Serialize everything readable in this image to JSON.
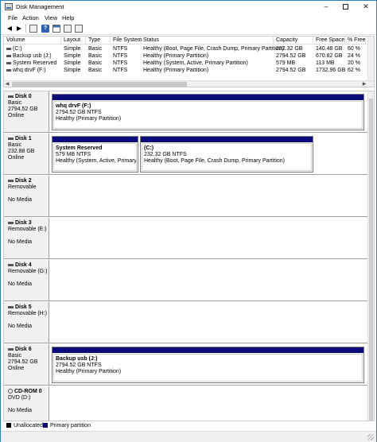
{
  "window": {
    "title": "Disk Management"
  },
  "menu": [
    "File",
    "Action",
    "View",
    "Help"
  ],
  "toolbar": {
    "icons": [
      "back-icon",
      "forward-icon",
      "properties-icon",
      "help-icon",
      "console-icon",
      "help-topics-icon",
      "settings-icon"
    ],
    "help_glyph": "?"
  },
  "volume_list": {
    "columns": [
      "Volume",
      "Layout",
      "Type",
      "File System",
      "Status",
      "Capacity",
      "Free Space",
      "% Free"
    ],
    "rows": [
      [
        "(C:)",
        "Simple",
        "Basic",
        "NTFS",
        "Healthy (Boot, Page File, Crash Dump, Primary Partition)",
        "232.32 GB",
        "140.48 GB",
        "60 %"
      ],
      [
        "Backup usb (J:)",
        "Simple",
        "Basic",
        "NTFS",
        "Healthy (Primary Partition)",
        "2794.52 GB",
        "670.82 GB",
        "24 %"
      ],
      [
        "System Reserved",
        "Simple",
        "Basic",
        "NTFS",
        "Healthy (System, Active, Primary Partition)",
        "579 MB",
        "113 MB",
        "20 %"
      ],
      [
        "whq drvF (F:)",
        "Simple",
        "Basic",
        "NTFS",
        "Healthy (Primary Partition)",
        "2794.52 GB",
        "1732.96 GB",
        "62 %"
      ]
    ]
  },
  "disks": [
    {
      "name": "Disk 0",
      "type": "Basic",
      "size": "2794.52 GB",
      "state": "Online",
      "partitions": [
        {
          "name": "whq drvF  (F:)",
          "size": "2794.52 GB NTFS",
          "status": "Healthy (Primary Partition)"
        }
      ]
    },
    {
      "name": "Disk 1",
      "type": "Basic",
      "size": "232.88 GB",
      "state": "Online",
      "partitions": [
        {
          "name": "System Reserved",
          "size": "579 MB NTFS",
          "status": "Healthy (System, Active, Primary Par"
        },
        {
          "name": "(C:)",
          "size": "232.32 GB NTFS",
          "status": "Healthy (Boot, Page File, Crash Dump, Primary Partition)"
        }
      ]
    },
    {
      "name": "Disk 2",
      "type": "Removable",
      "state": "No Media"
    },
    {
      "name": "Disk 3",
      "type": "Removable (E:)",
      "state": "No Media"
    },
    {
      "name": "Disk 4",
      "type": "Removable (G:)",
      "state": "No Media"
    },
    {
      "name": "Disk 5",
      "type": "Removable (H:)",
      "state": "No Media"
    },
    {
      "name": "Disk 6",
      "type": "Basic",
      "size": "2794.52 GB",
      "state": "Online",
      "partitions": [
        {
          "name": "Backup usb  (J:)",
          "size": "2794.52 GB NTFS",
          "status": "Healthy (Primary Partition)"
        }
      ]
    },
    {
      "name": "CD-ROM 0",
      "type": "DVD (D:)",
      "state": "No Media"
    }
  ],
  "legend": [
    {
      "label": "Unallocated",
      "color": "#000000"
    },
    {
      "label": "Primary partition",
      "color": "#0b0b7a"
    }
  ]
}
